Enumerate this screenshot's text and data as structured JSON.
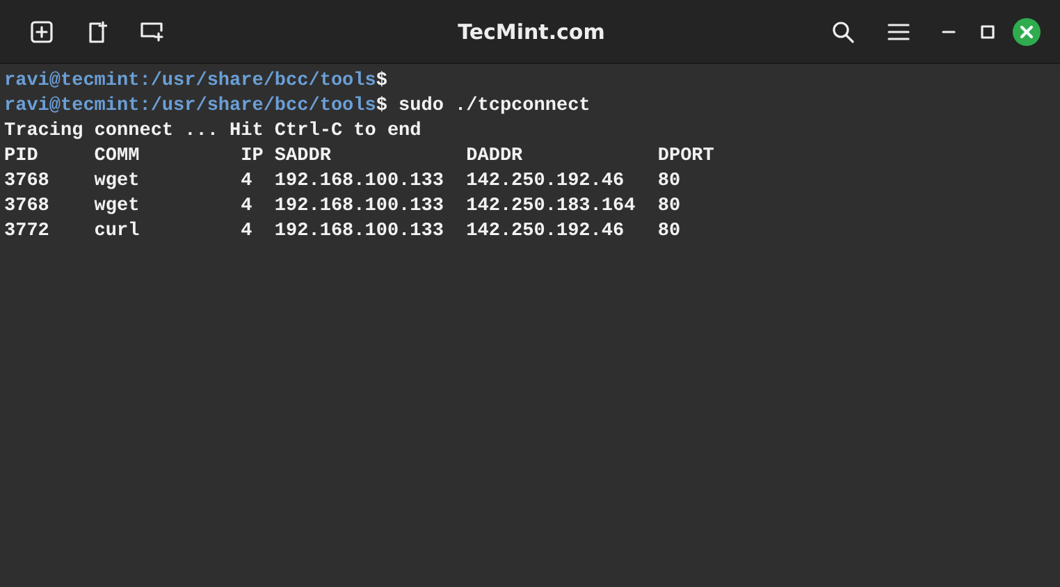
{
  "window": {
    "title": "TecMint.com"
  },
  "terminal": {
    "lines": [
      {
        "kind": "prompt",
        "prompt": "ravi@tecmint:/usr/share/bcc/tools",
        "command": "$"
      },
      {
        "kind": "prompt",
        "prompt": "ravi@tecmint:/usr/share/bcc/tools",
        "command": "$ sudo ./tcpconnect"
      },
      {
        "kind": "output",
        "text": "Tracing connect ... Hit Ctrl-C to end"
      },
      {
        "kind": "output",
        "text": "PID     COMM         IP SADDR            DADDR            DPORT"
      },
      {
        "kind": "output",
        "text": "3768    wget         4  192.168.100.133  142.250.192.46   80"
      },
      {
        "kind": "output",
        "text": "3768    wget         4  192.168.100.133  142.250.183.164  80"
      },
      {
        "kind": "output",
        "text": "3772    curl         4  192.168.100.133  142.250.192.46   80"
      }
    ]
  }
}
